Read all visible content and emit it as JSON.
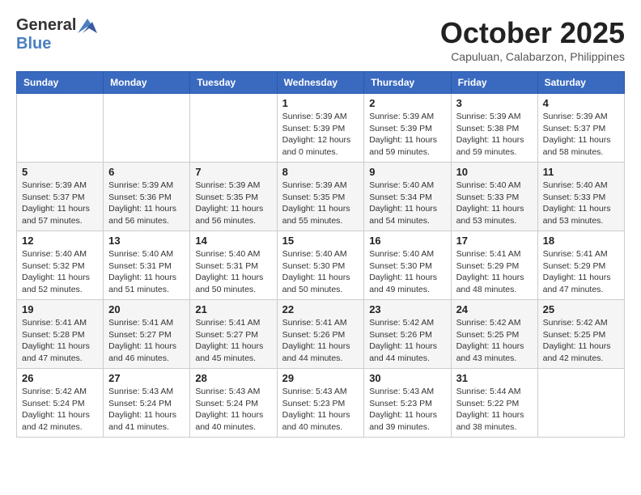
{
  "logo": {
    "general": "General",
    "blue": "Blue"
  },
  "title": "October 2025",
  "location": "Capuluan, Calabarzon, Philippines",
  "days_of_week": [
    "Sunday",
    "Monday",
    "Tuesday",
    "Wednesday",
    "Thursday",
    "Friday",
    "Saturday"
  ],
  "weeks": [
    [
      {
        "day": "",
        "info": ""
      },
      {
        "day": "",
        "info": ""
      },
      {
        "day": "",
        "info": ""
      },
      {
        "day": "1",
        "info": "Sunrise: 5:39 AM\nSunset: 5:39 PM\nDaylight: 12 hours\nand 0 minutes."
      },
      {
        "day": "2",
        "info": "Sunrise: 5:39 AM\nSunset: 5:39 PM\nDaylight: 11 hours\nand 59 minutes."
      },
      {
        "day": "3",
        "info": "Sunrise: 5:39 AM\nSunset: 5:38 PM\nDaylight: 11 hours\nand 59 minutes."
      },
      {
        "day": "4",
        "info": "Sunrise: 5:39 AM\nSunset: 5:37 PM\nDaylight: 11 hours\nand 58 minutes."
      }
    ],
    [
      {
        "day": "5",
        "info": "Sunrise: 5:39 AM\nSunset: 5:37 PM\nDaylight: 11 hours\nand 57 minutes."
      },
      {
        "day": "6",
        "info": "Sunrise: 5:39 AM\nSunset: 5:36 PM\nDaylight: 11 hours\nand 56 minutes."
      },
      {
        "day": "7",
        "info": "Sunrise: 5:39 AM\nSunset: 5:35 PM\nDaylight: 11 hours\nand 56 minutes."
      },
      {
        "day": "8",
        "info": "Sunrise: 5:39 AM\nSunset: 5:35 PM\nDaylight: 11 hours\nand 55 minutes."
      },
      {
        "day": "9",
        "info": "Sunrise: 5:40 AM\nSunset: 5:34 PM\nDaylight: 11 hours\nand 54 minutes."
      },
      {
        "day": "10",
        "info": "Sunrise: 5:40 AM\nSunset: 5:33 PM\nDaylight: 11 hours\nand 53 minutes."
      },
      {
        "day": "11",
        "info": "Sunrise: 5:40 AM\nSunset: 5:33 PM\nDaylight: 11 hours\nand 53 minutes."
      }
    ],
    [
      {
        "day": "12",
        "info": "Sunrise: 5:40 AM\nSunset: 5:32 PM\nDaylight: 11 hours\nand 52 minutes."
      },
      {
        "day": "13",
        "info": "Sunrise: 5:40 AM\nSunset: 5:31 PM\nDaylight: 11 hours\nand 51 minutes."
      },
      {
        "day": "14",
        "info": "Sunrise: 5:40 AM\nSunset: 5:31 PM\nDaylight: 11 hours\nand 50 minutes."
      },
      {
        "day": "15",
        "info": "Sunrise: 5:40 AM\nSunset: 5:30 PM\nDaylight: 11 hours\nand 50 minutes."
      },
      {
        "day": "16",
        "info": "Sunrise: 5:40 AM\nSunset: 5:30 PM\nDaylight: 11 hours\nand 49 minutes."
      },
      {
        "day": "17",
        "info": "Sunrise: 5:41 AM\nSunset: 5:29 PM\nDaylight: 11 hours\nand 48 minutes."
      },
      {
        "day": "18",
        "info": "Sunrise: 5:41 AM\nSunset: 5:29 PM\nDaylight: 11 hours\nand 47 minutes."
      }
    ],
    [
      {
        "day": "19",
        "info": "Sunrise: 5:41 AM\nSunset: 5:28 PM\nDaylight: 11 hours\nand 47 minutes."
      },
      {
        "day": "20",
        "info": "Sunrise: 5:41 AM\nSunset: 5:27 PM\nDaylight: 11 hours\nand 46 minutes."
      },
      {
        "day": "21",
        "info": "Sunrise: 5:41 AM\nSunset: 5:27 PM\nDaylight: 11 hours\nand 45 minutes."
      },
      {
        "day": "22",
        "info": "Sunrise: 5:41 AM\nSunset: 5:26 PM\nDaylight: 11 hours\nand 44 minutes."
      },
      {
        "day": "23",
        "info": "Sunrise: 5:42 AM\nSunset: 5:26 PM\nDaylight: 11 hours\nand 44 minutes."
      },
      {
        "day": "24",
        "info": "Sunrise: 5:42 AM\nSunset: 5:25 PM\nDaylight: 11 hours\nand 43 minutes."
      },
      {
        "day": "25",
        "info": "Sunrise: 5:42 AM\nSunset: 5:25 PM\nDaylight: 11 hours\nand 42 minutes."
      }
    ],
    [
      {
        "day": "26",
        "info": "Sunrise: 5:42 AM\nSunset: 5:24 PM\nDaylight: 11 hours\nand 42 minutes."
      },
      {
        "day": "27",
        "info": "Sunrise: 5:43 AM\nSunset: 5:24 PM\nDaylight: 11 hours\nand 41 minutes."
      },
      {
        "day": "28",
        "info": "Sunrise: 5:43 AM\nSunset: 5:24 PM\nDaylight: 11 hours\nand 40 minutes."
      },
      {
        "day": "29",
        "info": "Sunrise: 5:43 AM\nSunset: 5:23 PM\nDaylight: 11 hours\nand 40 minutes."
      },
      {
        "day": "30",
        "info": "Sunrise: 5:43 AM\nSunset: 5:23 PM\nDaylight: 11 hours\nand 39 minutes."
      },
      {
        "day": "31",
        "info": "Sunrise: 5:44 AM\nSunset: 5:22 PM\nDaylight: 11 hours\nand 38 minutes."
      },
      {
        "day": "",
        "info": ""
      }
    ]
  ]
}
